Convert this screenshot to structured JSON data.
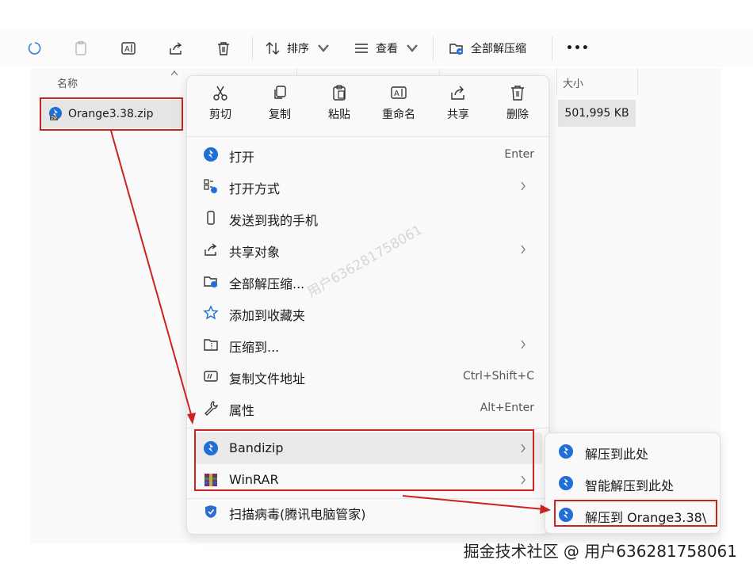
{
  "toolbar": {
    "sort_label": "排序",
    "view_label": "查看",
    "extract_all_label": "全部解压缩",
    "more_label": "•••"
  },
  "columns": {
    "name": "名称",
    "size": "大小"
  },
  "file": {
    "name": "Orange3.38.zip",
    "size": "501,995 KB"
  },
  "context_menu": {
    "quick_actions": [
      {
        "label": "剪切",
        "icon": "scissors-icon"
      },
      {
        "label": "复制",
        "icon": "copy-icon"
      },
      {
        "label": "粘贴",
        "icon": "paste-icon"
      },
      {
        "label": "重命名",
        "icon": "rename-icon"
      },
      {
        "label": "共享",
        "icon": "share-icon"
      },
      {
        "label": "删除",
        "icon": "trash-icon"
      }
    ],
    "items": [
      {
        "label": "打开",
        "shortcut": "Enter",
        "icon": "bandizip-icon"
      },
      {
        "label": "打开方式",
        "shortcut": "",
        "icon": "open-with-icon",
        "submenu": true
      },
      {
        "label": "发送到我的手机",
        "shortcut": "",
        "icon": "phone-icon"
      },
      {
        "label": "共享对象",
        "shortcut": "",
        "icon": "share-icon",
        "submenu": true
      },
      {
        "label": "全部解压缩...",
        "shortcut": "",
        "icon": "extract-folder-icon"
      },
      {
        "label": "添加到收藏夹",
        "shortcut": "",
        "icon": "star-icon"
      },
      {
        "label": "压缩到...",
        "shortcut": "",
        "icon": "zip-folder-icon",
        "submenu": true
      },
      {
        "label": "复制文件地址",
        "shortcut": "Ctrl+Shift+C",
        "icon": "copy-path-icon"
      },
      {
        "label": "属性",
        "shortcut": "Alt+Enter",
        "icon": "wrench-icon"
      },
      {
        "label": "Bandizip",
        "shortcut": "",
        "icon": "bandizip-icon",
        "submenu": true
      },
      {
        "label": "WinRAR",
        "shortcut": "",
        "icon": "winrar-icon",
        "submenu": true
      },
      {
        "label": "扫描病毒(腾讯电脑管家)",
        "shortcut": "",
        "icon": "shield-icon"
      }
    ]
  },
  "submenu": {
    "items": [
      {
        "label": "解压到此处"
      },
      {
        "label": "智能解压到此处"
      },
      {
        "label": "解压到 Orange3.38\\"
      }
    ]
  },
  "watermark": {
    "diagonal": "用户636281758061",
    "footer": "掘金技术社区 @ 用户636281758061"
  },
  "colors": {
    "accent_blue": "#1f6fd6",
    "highlight_red": "#cc2222"
  }
}
